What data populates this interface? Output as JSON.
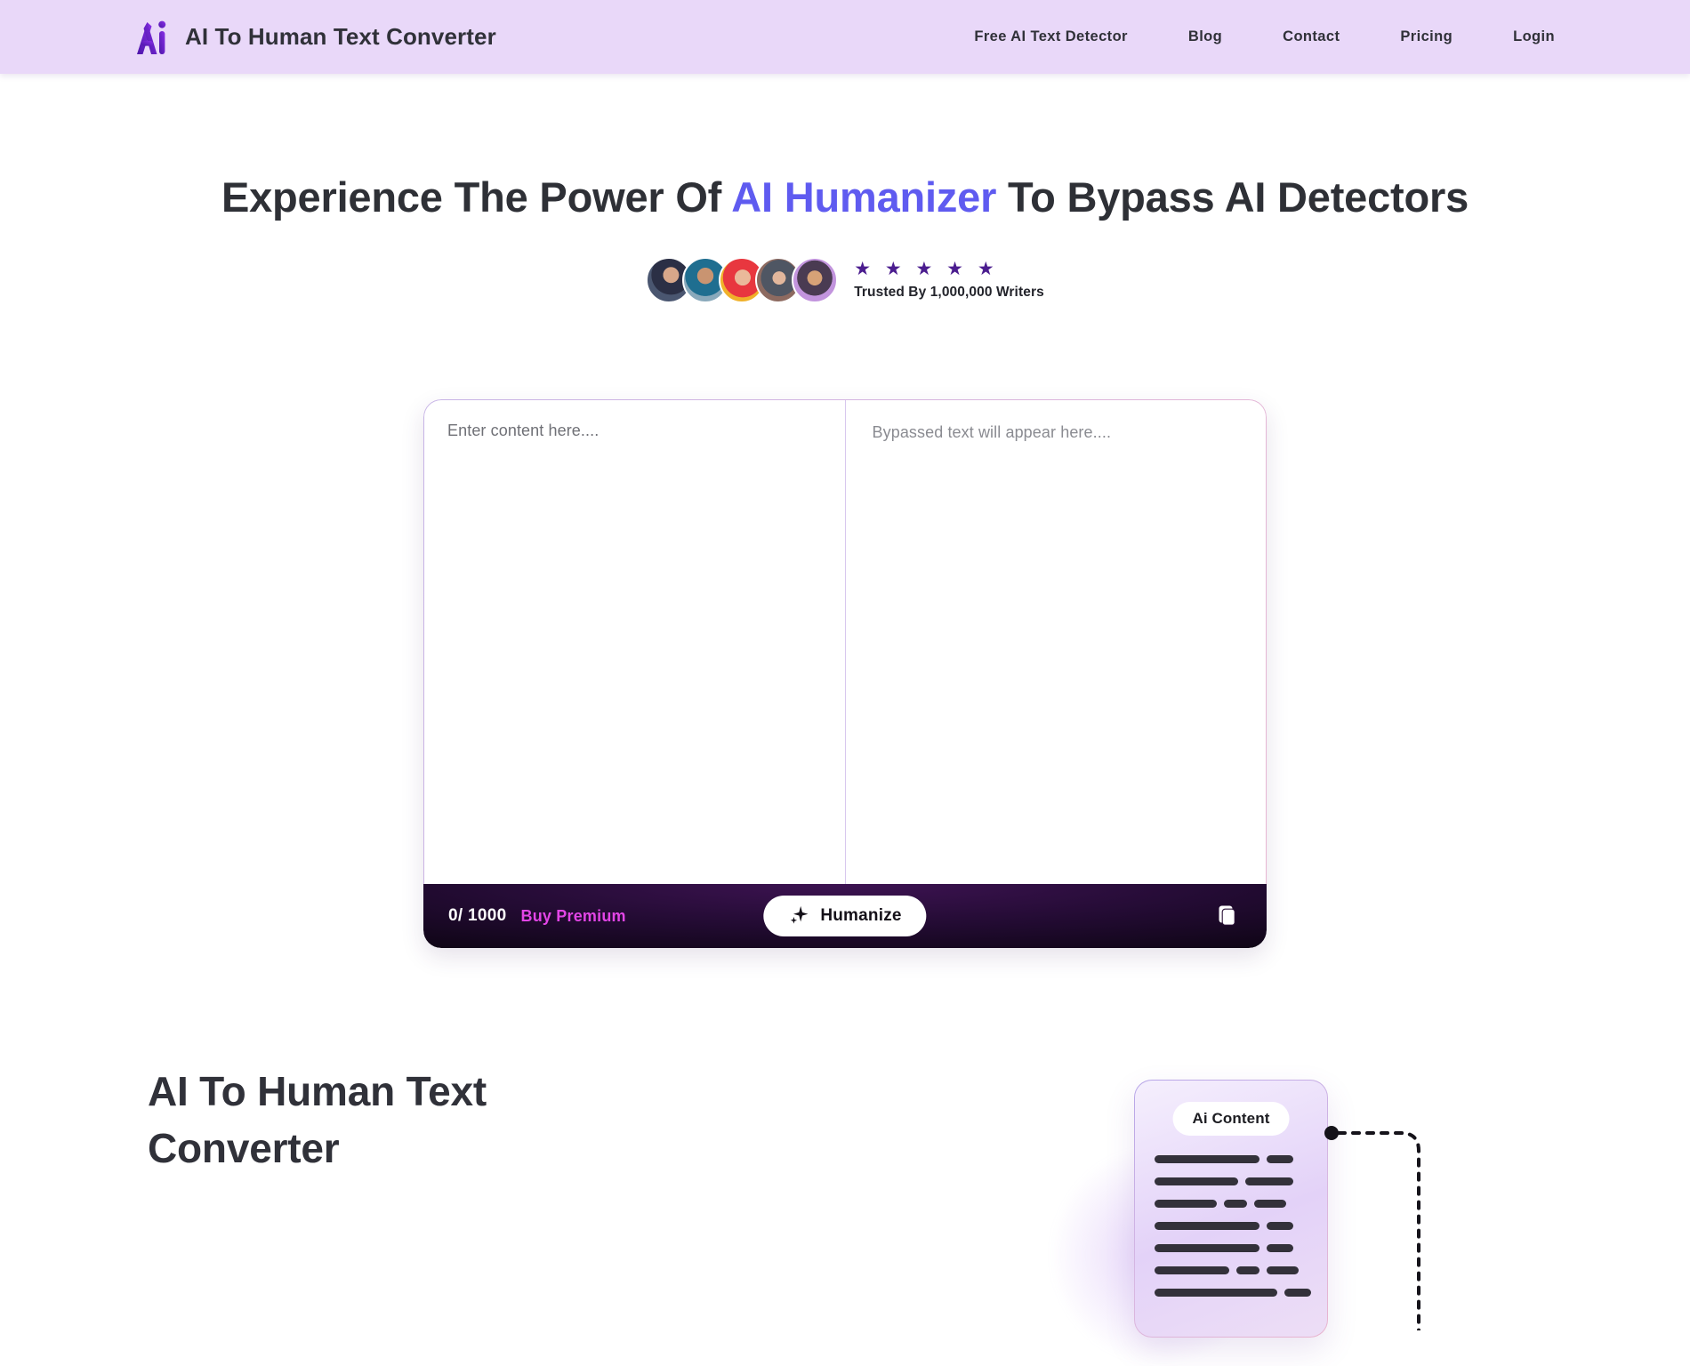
{
  "header": {
    "logo_icon": "ai-logo-icon",
    "brand_title": "AI To Human Text Converter",
    "nav": [
      {
        "label": "Free AI Text Detector"
      },
      {
        "label": "Blog"
      },
      {
        "label": "Contact"
      },
      {
        "label": "Pricing"
      },
      {
        "label": "Login"
      }
    ]
  },
  "hero": {
    "title_part1": "Experience The Power Of ",
    "title_accent": "AI Humanizer",
    "title_part2": " To Bypass AI Detectors",
    "stars": "★ ★ ★ ★ ★",
    "star_count": 5,
    "trusted_label": "Trusted By 1,000,000 Writers",
    "avatar_count": 5
  },
  "editor": {
    "input_placeholder": "Enter content here....",
    "input_value": "",
    "output_placeholder": "Bypassed text will appear here....",
    "output_value": "",
    "counter": "0/ 1000",
    "char_used": 0,
    "char_limit": 1000,
    "buy_premium_label": "Buy Premium",
    "humanize_label": "Humanize",
    "humanize_icon": "sparkle-icon",
    "copy_icon": "copy-icon"
  },
  "lower": {
    "section_title": "AI To Human Text Converter",
    "illustration": {
      "card_chip_label": "Ai Content",
      "connector_icon": "dotted-connector-icon"
    }
  },
  "colors": {
    "header_bg": "#e9d8f9",
    "accent_blue": "#5f5bf0",
    "accent_purple": "#5b1f9c",
    "accent_magenta": "#e245e6",
    "toolbar_bg": "#140720",
    "text_dark": "#303139"
  }
}
